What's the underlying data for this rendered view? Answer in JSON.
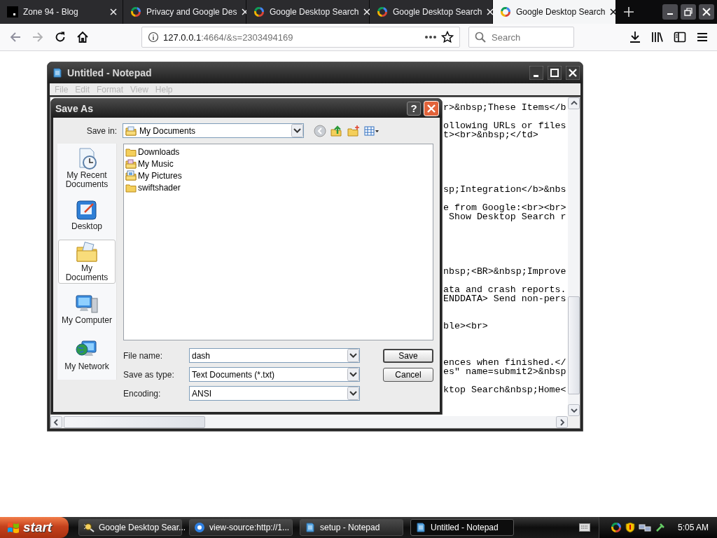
{
  "browser": {
    "tabs": [
      {
        "title": "Zone 94 - Blog",
        "kind": "page",
        "selected": false
      },
      {
        "title": "Privacy and Google Des",
        "kind": "ring",
        "selected": false
      },
      {
        "title": "Google Desktop Search",
        "kind": "ring",
        "selected": false
      },
      {
        "title": "Google Desktop Search",
        "kind": "ring",
        "selected": false
      },
      {
        "title": "Google Desktop Search",
        "kind": "ring",
        "selected": true
      }
    ],
    "url": {
      "host": "127.0.0.1",
      "path": ":4664/&s=2303494169"
    },
    "search": {
      "placeholder": "Search"
    }
  },
  "notepad": {
    "title": "Untitled - Notepad",
    "menu": [
      {
        "label": "File",
        "disabled": true
      },
      {
        "label": "Edit",
        "disabled": true
      },
      {
        "label": "Format",
        "disabled": true
      },
      {
        "label": "View",
        "disabled": true
      },
      {
        "label": "Help",
        "disabled": true
      }
    ],
    "text_blocks": [
      [
        "r>&nbsp;These Items</b"
      ],
      [
        "ollowing URLs or files",
        "t><br>&nbsp;</td>"
      ],
      [
        "sp;Integration</b>&nbs"
      ],
      [
        "e from Google:<br><br>",
        " Show Desktop Search r"
      ],
      [
        "nbsp;<BR>&nbsp;Improve"
      ],
      [
        "ata and crash reports.",
        "ENDDATA> Send non-pers"
      ],
      [
        "ble><br>"
      ],
      [
        "ences when finished.</",
        "es\" name=submit2>&nbsp"
      ],
      [
        "ktop Search&nbsp;Home<"
      ]
    ]
  },
  "save_dialog": {
    "title": "Save As",
    "help": "?",
    "save_in": {
      "label": "Save in:",
      "value": "My Documents"
    },
    "places": [
      {
        "label": "My Recent Documents",
        "kind": "recent",
        "selected": false
      },
      {
        "label": "Desktop",
        "kind": "desktop",
        "selected": false
      },
      {
        "label": "My Documents",
        "kind": "documents",
        "selected": true
      },
      {
        "label": "My Computer",
        "kind": "computer",
        "selected": false
      },
      {
        "label": "My Network",
        "kind": "network",
        "selected": false
      }
    ],
    "files": [
      {
        "name": "Downloads",
        "kind": "folder"
      },
      {
        "name": "My Music",
        "kind": "music"
      },
      {
        "name": "My Pictures",
        "kind": "pictures"
      },
      {
        "name": "swiftshader",
        "kind": "folder"
      }
    ],
    "fields": [
      {
        "label": "File name:",
        "value": "dash"
      },
      {
        "label": "Save as type:",
        "value": "Text Documents (*.txt)"
      },
      {
        "label": "Encoding:",
        "value": "ANSI"
      }
    ],
    "buttons": [
      "Save",
      "Cancel"
    ]
  },
  "taskbar": {
    "start": "start",
    "items": [
      {
        "title": "Google Desktop Sear...",
        "kind": "gds",
        "selected": false
      },
      {
        "title": "view-source:http://1...",
        "kind": "browser",
        "selected": false
      },
      {
        "title": "setup - Notepad",
        "kind": "notepad",
        "selected": false
      },
      {
        "title": "Untitled - Notepad",
        "kind": "notepad",
        "selected": true
      }
    ],
    "clock": "5:05 AM"
  }
}
